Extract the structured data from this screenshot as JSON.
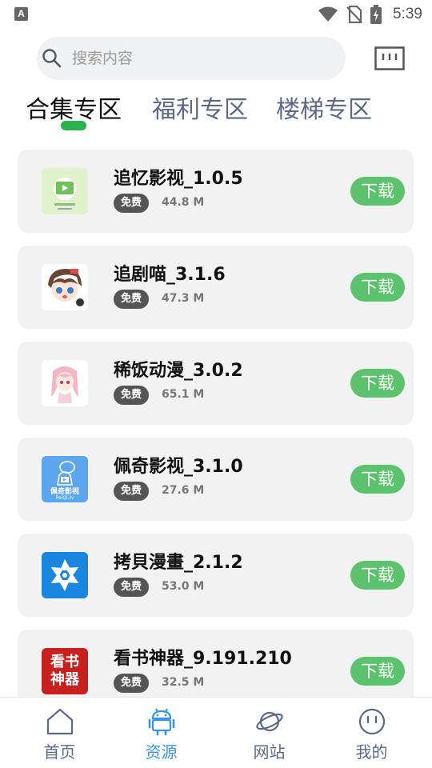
{
  "status_bar": {
    "time": "5:39",
    "notification_icon_letter": "A"
  },
  "search": {
    "placeholder": "搜索内容"
  },
  "tabs": [
    {
      "label": "合集专区",
      "active": true
    },
    {
      "label": "福利专区",
      "active": false
    },
    {
      "label": "楼梯专区",
      "active": false
    }
  ],
  "apps": [
    {
      "name": "追忆影视_1.0.5",
      "badge": "免费",
      "size": "44.8 M",
      "download_label": "下载",
      "icon": "zhuiyi-app-icon"
    },
    {
      "name": "追剧喵_3.1.6",
      "badge": "免费",
      "size": "47.3 M",
      "download_label": "下载",
      "icon": "zhuijumiao-app-icon"
    },
    {
      "name": "稀饭动漫_3.0.2",
      "badge": "免费",
      "size": "65.1 M",
      "download_label": "下载",
      "icon": "xifan-app-icon"
    },
    {
      "name": "佩奇影视_3.1.0",
      "badge": "免费",
      "size": "27.6 M",
      "download_label": "下载",
      "icon": "peiqi-app-icon",
      "icon_text": "佩奇影视",
      "icon_subtext": "PeiQi.tv"
    },
    {
      "name": "拷貝漫畫_2.1.2",
      "badge": "免费",
      "size": "53.0 M",
      "download_label": "下载",
      "icon": "kaobei-app-icon"
    },
    {
      "name": "看书神器_9.191.210",
      "badge": "免费",
      "size": "32.5 M",
      "download_label": "下载",
      "icon": "kanshu-app-icon",
      "icon_text_line1": "看书",
      "icon_text_line2": "神器"
    }
  ],
  "bottom_nav": [
    {
      "label": "首页",
      "icon": "home-icon",
      "active": false
    },
    {
      "label": "资源",
      "icon": "android-icon",
      "active": true
    },
    {
      "label": "网站",
      "icon": "planet-icon",
      "active": false
    },
    {
      "label": "我的",
      "icon": "smiley-icon",
      "active": false
    }
  ],
  "colors": {
    "accent_green": "#5cc26e",
    "tab_indicator": "#2bb24c",
    "active_nav": "#3596e8",
    "inactive_nav": "#5a6a84",
    "card_background": "#f2f2f2"
  }
}
